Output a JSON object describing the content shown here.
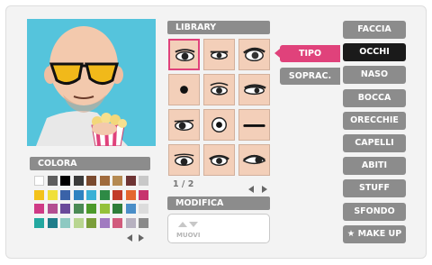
{
  "colora": {
    "title": "COLORA"
  },
  "library": {
    "title": "LIBRARY",
    "page": "1 / 2"
  },
  "modifica": {
    "title": "MODIFICA",
    "move_label": "MUOVI"
  },
  "subtabs": {
    "tipo": "TIPO",
    "soprac": "SOPRAC."
  },
  "categories": [
    {
      "label": "FACCIA",
      "active": false
    },
    {
      "label": "OCCHI",
      "active": true
    },
    {
      "label": "NASO",
      "active": false
    },
    {
      "label": "BOCCA",
      "active": false
    },
    {
      "label": "ORECCHIE",
      "active": false
    },
    {
      "label": "CAPELLI",
      "active": false
    },
    {
      "label": "ABITI",
      "active": false
    },
    {
      "label": "STUFF",
      "active": false
    },
    {
      "label": "SFONDO",
      "active": false
    },
    {
      "label": "★ MAKE UP",
      "active": false
    }
  ],
  "palette": [
    [
      "#ffffff",
      "#5e5e5e",
      "#000000",
      "#3b3b3b",
      "#7a4a2e",
      "#a06a3c",
      "#b58a52",
      "#6e3434",
      "#c8c8c8"
    ],
    [
      "#f3c21b",
      "#f0e03a",
      "#3a62a8",
      "#2f83c1",
      "#3bb0d6",
      "#2e8a45",
      "#c23a2a",
      "#e4662e",
      "#c7356e"
    ],
    [
      "#cf3b86",
      "#b34f91",
      "#6a4a9a",
      "#4b8a55",
      "#4c9a2a",
      "#95c13a",
      "#2f7e3a",
      "#4a8ec8",
      "#dcdcdc"
    ],
    [
      "#23a8a0",
      "#1f7d8a",
      "#8dc9c2",
      "#b8d590",
      "#7a9e3a",
      "#a07ac0",
      "#d15b7c",
      "#b7b1c0",
      "#8a8a8a"
    ]
  ],
  "selected_eye_index": 0
}
